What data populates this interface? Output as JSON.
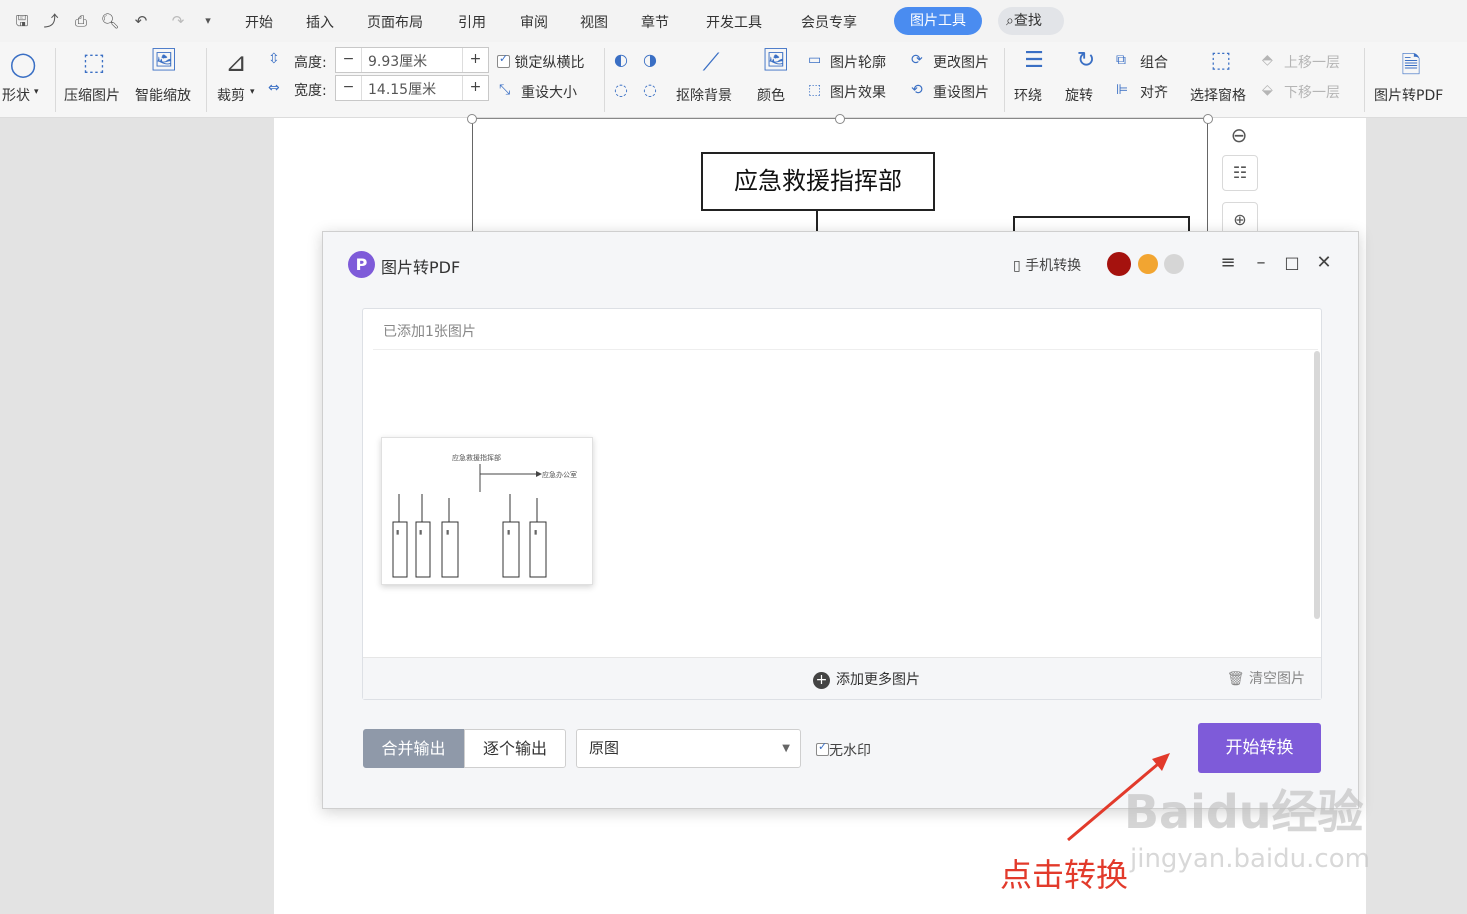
{
  "menubar": {
    "tabs": [
      "开始",
      "插入",
      "页面布局",
      "引用",
      "审阅",
      "视图",
      "章节",
      "开发工具",
      "会员专享"
    ],
    "active_tab": "图片工具",
    "search": "查找"
  },
  "ribbon": {
    "shape": "形状",
    "compress": "压缩图片",
    "smart_zoom": "智能缩放",
    "crop": "裁剪",
    "height_label": "高度:",
    "height_value": "9.93厘米",
    "width_label": "宽度:",
    "width_value": "14.15厘米",
    "lock_ratio": "锁定纵横比",
    "reset_size": "重设大小",
    "remove_bg": "抠除背景",
    "color": "颜色",
    "outline": "图片轮廓",
    "effect": "图片效果",
    "change_pic": "更改图片",
    "reset_pic": "重设图片",
    "wrap": "环绕",
    "rotate": "旋转",
    "group": "组合",
    "align": "对齐",
    "select_pane": "选择窗格",
    "bring_forward": "上移一层",
    "send_backward": "下移一层",
    "pic_to_pdf": "图片转PDF"
  },
  "document": {
    "org_top": "应急救援指挥部"
  },
  "dialog": {
    "title": "图片转PDF",
    "phone_convert": "手机转换",
    "added_count": "已添加1张图片",
    "add_more": "添加更多图片",
    "clear": "清空图片",
    "merge_output": "合并输出",
    "each_output": "逐个输出",
    "quality": "原图",
    "no_watermark": "无水印",
    "start": "开始转换"
  },
  "thumbnail": {
    "top": "应急救援指挥部",
    "right": "应急办公室",
    "columns": [
      "抢险救灾组",
      "后勤保障组",
      "医疗救护组",
      "警戒疏散组",
      "专家技术组"
    ]
  },
  "annotation": "点击转换",
  "watermark": {
    "brand": "Baidu经验",
    "url": "jingyan.baidu.com"
  },
  "colors": {
    "accent_purple": "#7e5bd9",
    "tab_blue": "#4a8cf0",
    "annotation_red": "#e23a2b"
  }
}
